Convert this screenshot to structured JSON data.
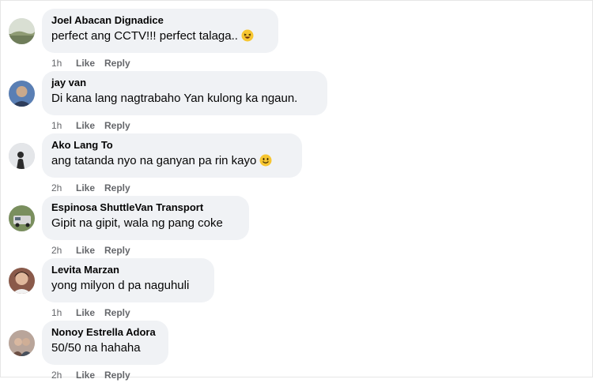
{
  "comments": [
    {
      "author": "Joel Abacan Dignadice",
      "text": "perfect ang CCTV!!! perfect talaga..",
      "emoji": "laughing-emoji",
      "time": "1h",
      "like": "Like",
      "reply": "Reply"
    },
    {
      "author": "jay van",
      "text": "Di kana lang nagtrabaho Yan kulong ka ngaun.",
      "time": "1h",
      "like": "Like",
      "reply": "Reply"
    },
    {
      "author": "Ako Lang To",
      "text": "ang tatanda nyo na ganyan pa rin kayo",
      "emoji": "smiling-emoji",
      "time": "2h",
      "like": "Like",
      "reply": "Reply"
    },
    {
      "author": "Espinosa ShuttleVan Transport",
      "text": "Gipit na gipit, wala ng pang coke",
      "time": "2h",
      "like": "Like",
      "reply": "Reply"
    },
    {
      "author": "Levita Marzan",
      "text": "yong milyon d pa naguhuli",
      "time": "1h",
      "like": "Like",
      "reply": "Reply"
    },
    {
      "author": "Nonoy Estrella Adora",
      "text": "50/50 na hahaha",
      "time": "2h",
      "like": "Like",
      "reply": "Reply"
    }
  ],
  "colors": {
    "bubble": "#f0f2f5",
    "name_text": "#050505",
    "meta_text": "#65676b",
    "emoji_face": "#f7c631"
  }
}
